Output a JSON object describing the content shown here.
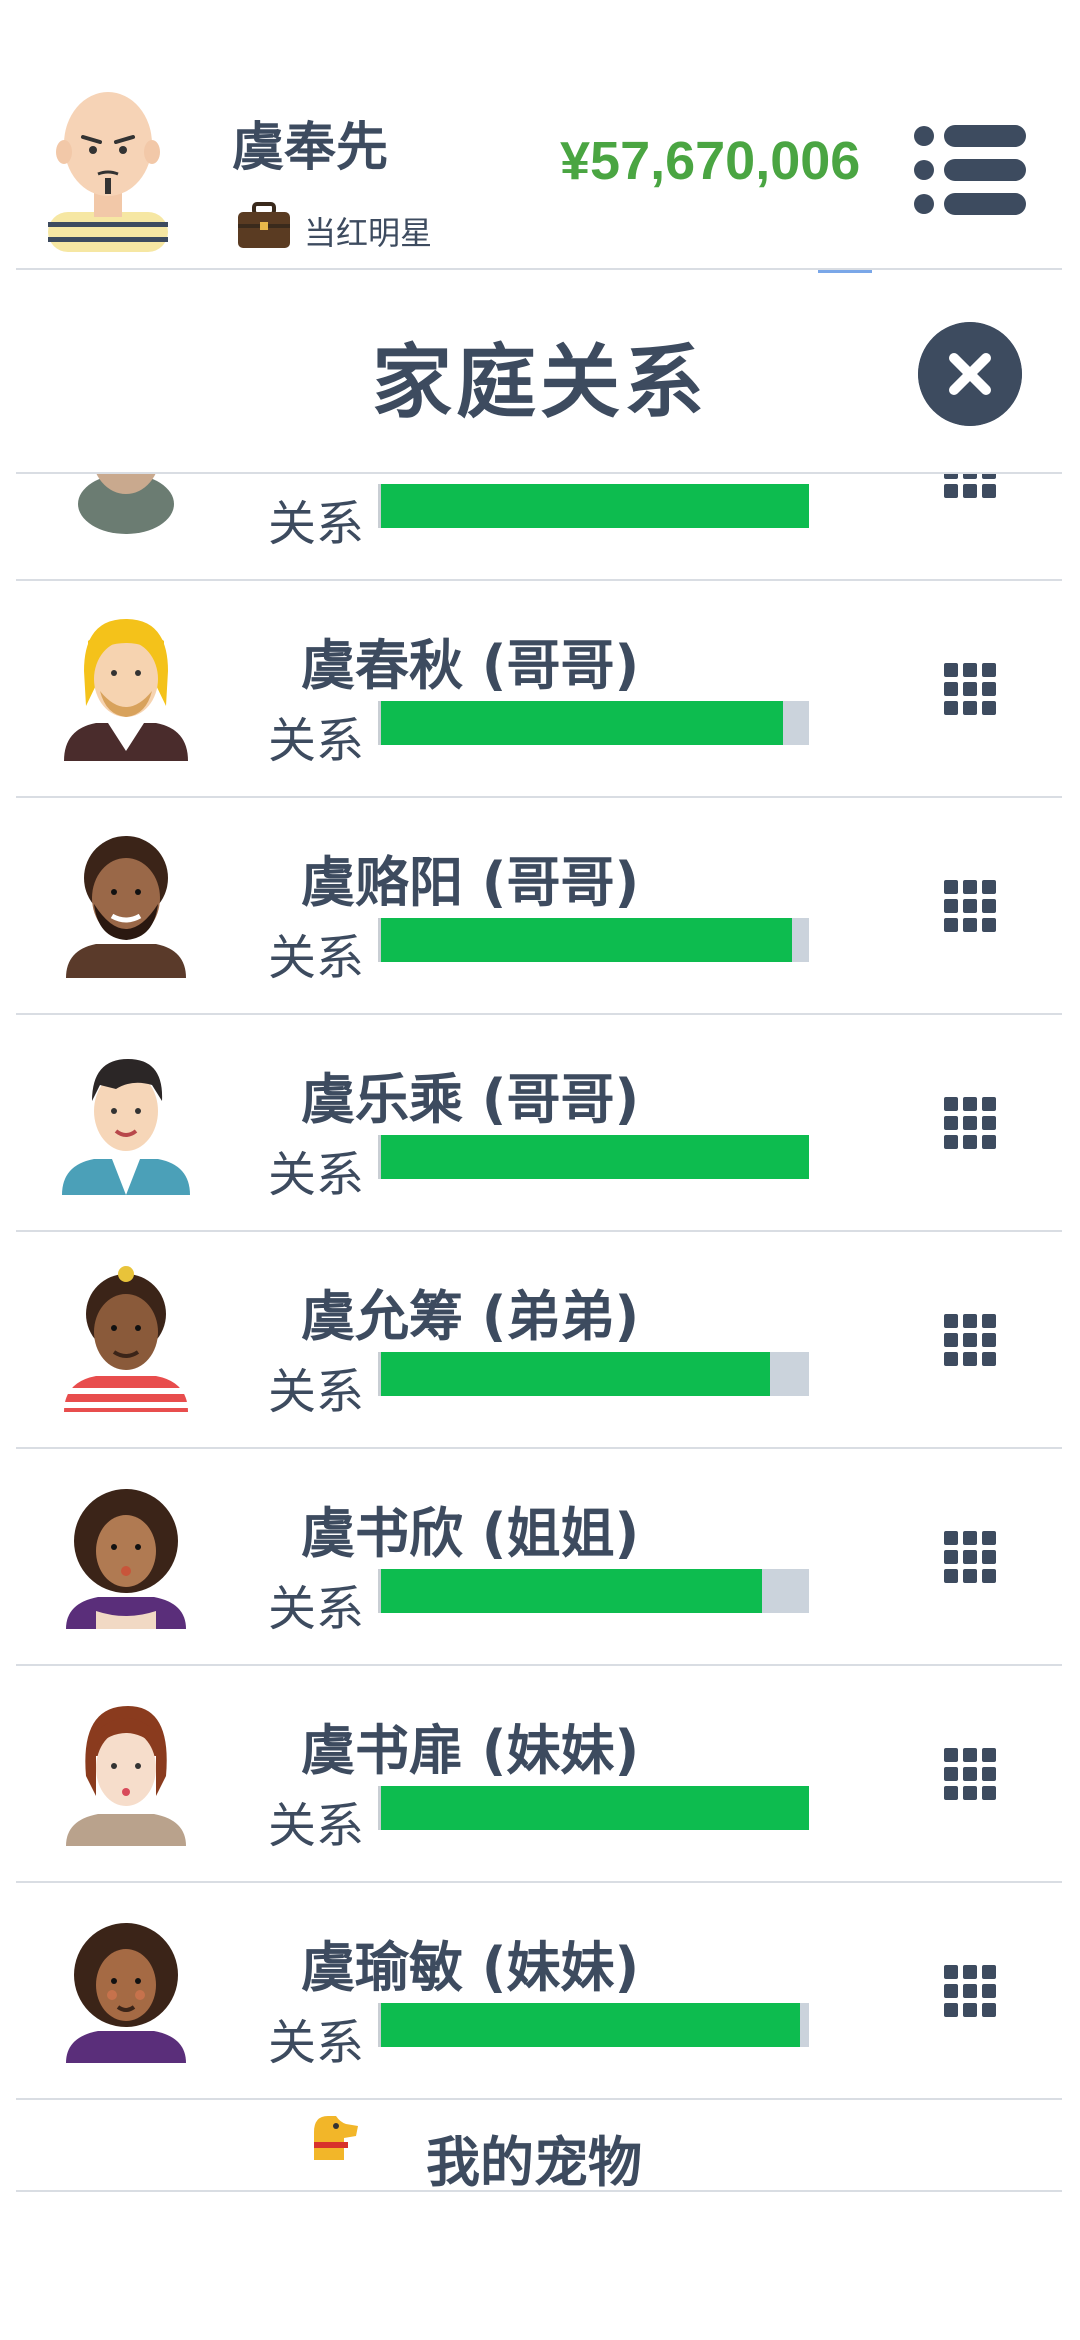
{
  "header": {
    "player_name": "虞奉先",
    "job_title": "当红明星",
    "money": "¥57,670,006",
    "job_icon": "briefcase-icon",
    "menu_icon": "list-menu-icon"
  },
  "modal": {
    "title": "家庭关系",
    "close_icon": "close-icon"
  },
  "relation_label": "关系",
  "members": [
    {
      "name": "",
      "relation_level": 1.0,
      "avatar": "avatar-partial-icon",
      "action_icon": "grid-menu-icon"
    },
    {
      "name": "虞春秋 (哥哥)",
      "relation_level": 0.94,
      "avatar": "avatar-blonde-bearded-man-icon",
      "action_icon": "grid-menu-icon"
    },
    {
      "name": "虞赂阳 (哥哥)",
      "relation_level": 0.96,
      "avatar": "avatar-curly-bearded-man-icon",
      "action_icon": "grid-menu-icon"
    },
    {
      "name": "虞乐乘 (哥哥)",
      "relation_level": 1.0,
      "avatar": "avatar-young-man-icon",
      "action_icon": "grid-menu-icon"
    },
    {
      "name": "虞允筹 (弟弟)",
      "relation_level": 0.91,
      "avatar": "avatar-striped-shirt-boy-icon",
      "action_icon": "grid-menu-icon"
    },
    {
      "name": "虞书欣 (姐姐)",
      "relation_level": 0.89,
      "avatar": "avatar-curly-woman-icon",
      "action_icon": "grid-menu-icon"
    },
    {
      "name": "虞书扉 (妹妹)",
      "relation_level": 1.0,
      "avatar": "avatar-brunette-woman-icon",
      "action_icon": "grid-menu-icon"
    },
    {
      "name": "虞瑜敏 (妹妹)",
      "relation_level": 0.98,
      "avatar": "avatar-curly-girl-icon",
      "action_icon": "grid-menu-icon"
    }
  ],
  "pets": {
    "label": "我的宠物",
    "icon": "dog-icon"
  },
  "colors": {
    "text": "#3d4b5f",
    "money": "#4aa542",
    "bar_fill": "#0dbc4f",
    "bar_track": "#cbd3dc",
    "divider": "#d9dde3"
  }
}
